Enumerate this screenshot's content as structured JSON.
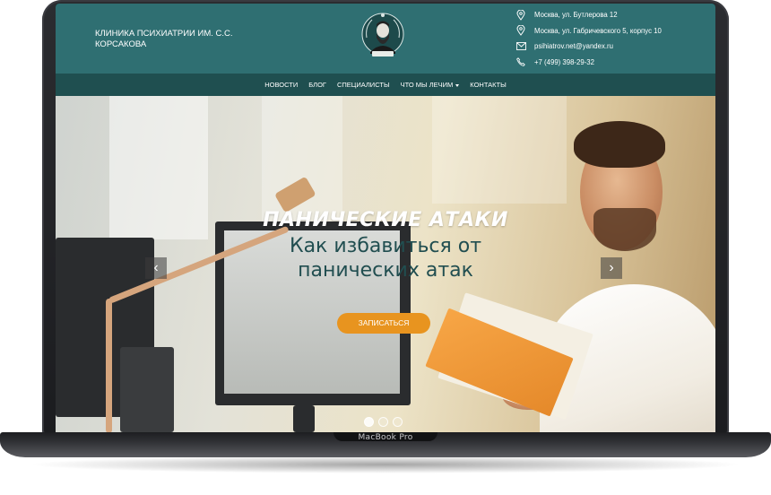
{
  "device": {
    "label": "MacBook Pro"
  },
  "header": {
    "clinic_name": "КЛИНИКА ПСИХИАТРИИ ИМ. С.С. КОРСАКОВА",
    "logo_icon": "portrait-emblem-icon",
    "contacts": [
      {
        "icon": "location-pin-icon",
        "text": "Москва, ул. Бутлерова 12"
      },
      {
        "icon": "location-pin-icon",
        "text": "Москва, ул. Габричевского 5, корпус 10"
      },
      {
        "icon": "email-icon",
        "text": "psihiatrov.net@yandex.ru"
      },
      {
        "icon": "phone-icon",
        "text": "+7 (499) 398-29-32"
      }
    ]
  },
  "nav": {
    "items": [
      {
        "label": "НОВОСТИ"
      },
      {
        "label": "БЛОГ"
      },
      {
        "label": "СПЕЦИАЛИСТЫ"
      },
      {
        "label": "ЧТО МЫ ЛЕЧИМ",
        "has_dropdown": true
      },
      {
        "label": "КОНТАКТЫ"
      }
    ]
  },
  "hero": {
    "title": "ПАНИЧЕСКИЕ АТАКИ",
    "subtitle_line1": "Как избавиться от",
    "subtitle_line2": "панических атак",
    "cta_label": "ЗАПИСАТЬСЯ",
    "prev_icon": "chevron-left-icon",
    "next_icon": "chevron-right-icon",
    "slides_total": 3,
    "active_slide": 1
  },
  "colors": {
    "header_bg": "#2f6f72",
    "nav_bg": "#1f4f50",
    "cta": "#e8941f",
    "subtitle": "#214e50"
  }
}
